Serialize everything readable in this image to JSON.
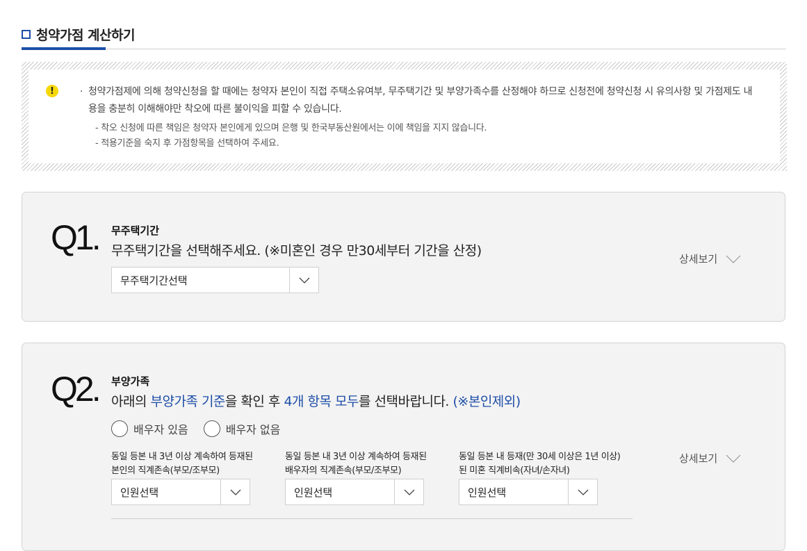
{
  "header": {
    "title": "청약가점 계산하기"
  },
  "notice": {
    "bullet": "·",
    "main_text": "청약가점제에 의해 청약신청을 할 때에는 청약자 본인이 직접 주택소유여부, 무주택기간 및 부양가족수를 산정해야 하므로 신청전에 청약신청 시 유의사항 및 가점제도 내용을 충분히 이해해야만 착오에 따른 불이익을 피할 수 있습니다.",
    "sub_items": [
      "- 착오 신청에 따른 책임은 청약자 본인에게 있으며 은행 및 한국부동산원에서는 이에 책임을 지지 않습니다.",
      "- 적용기준을 숙지 후 가점항목을 선택하여 주세요."
    ],
    "icon": "exclamation-icon",
    "icon_glyph": "!"
  },
  "q1": {
    "number": "Q1.",
    "label": "무주택기간",
    "text": "무주택기간을 선택해주세요. (※미혼인 경우 만30세부터 기간을 산정)",
    "select_value": "무주택기간선택",
    "detail_label": "상세보기"
  },
  "q2": {
    "number": "Q2.",
    "label": "부양가족",
    "text_parts": [
      "아래의 ",
      "부양가족 기준",
      "을 확인 후 ",
      "4개 항목 모두",
      "를 선택바랍니다. ",
      "(※본인제외)"
    ],
    "radios": [
      "배우자 있음",
      "배우자 없음"
    ],
    "columns": [
      {
        "label_line1": "동일 등본 내 3년 이상 계속하여 등재된",
        "label_line2": "본인의 직계존속(부모/조부모)",
        "select_value": "인원선택"
      },
      {
        "label_line1": "동일 등본 내 3년 이상 계속하여 등재된",
        "label_line2": "배우자의 직계존속(부모/조부모)",
        "select_value": "인원선택"
      },
      {
        "label_line1": "동일 등본 내 등재(만 30세 이상은 1년 이상)",
        "label_line2": "된 미혼 직계비속(자녀/손자녀)",
        "select_value": "인원선택"
      }
    ],
    "detail_label": "상세보기"
  },
  "colors": {
    "accent": "#1e4fa8",
    "warning": "#f5d80a",
    "box_bg": "#f3f3f3"
  }
}
